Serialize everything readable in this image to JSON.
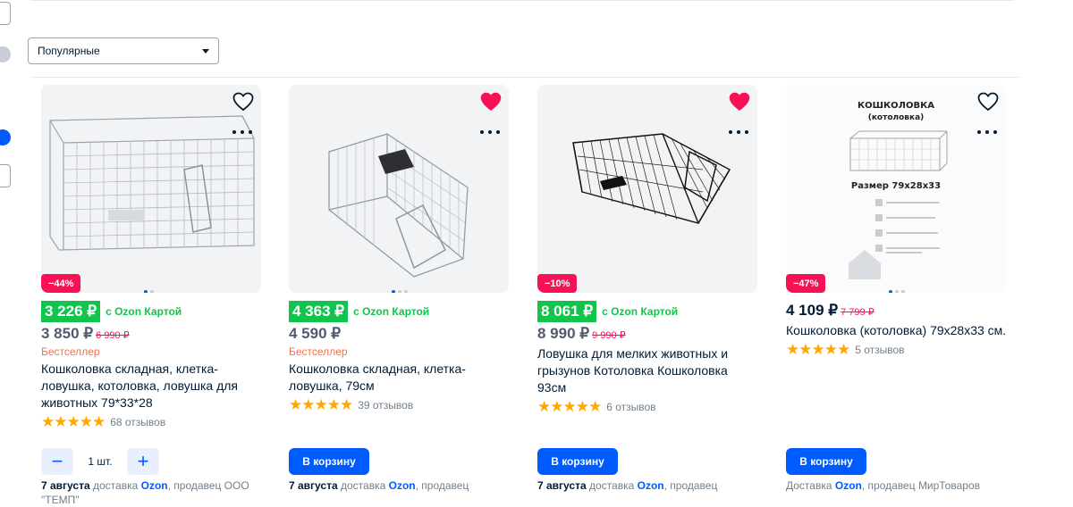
{
  "sort": {
    "label": "Популярные"
  },
  "cart_label": "В корзину",
  "stepper": {
    "minus": "−",
    "plus": "+",
    "qty": "1 шт."
  },
  "colors": {
    "accent": "#005bff",
    "green": "#10c44c",
    "discount": "#f91155",
    "bestseller": "#f1724d",
    "star": "#ffa800"
  },
  "products": [
    {
      "discount": "−44%",
      "card_price": "3 226 ₽",
      "ozon_card_label": "с Ozon Картой",
      "price": "3 850 ₽",
      "old_price": "6 990 ₽",
      "badge": "Бестселлер",
      "title": "Кошколовка складная, клетка-ловушка, котоловка, ловушка для животных 79*33*28",
      "stars": "★★★★★",
      "reviews": "68 отзывов",
      "favorite": false,
      "delivery_date": "7 августа",
      "delivery_text": "доставка",
      "delivery_ozon": "Ozon",
      "delivery_seller": ", продавец ООО \"ТЕМП\""
    },
    {
      "discount": "",
      "card_price": "4 363 ₽",
      "ozon_card_label": "с Ozon Картой",
      "price": "4 590 ₽",
      "old_price": "",
      "badge": "Бестселлер",
      "title": "Кошколовка складная, клетка-ловушка, 79см",
      "stars": "★★★★★",
      "reviews": "39 отзывов",
      "favorite": true,
      "delivery_date": "7 августа",
      "delivery_text": "доставка",
      "delivery_ozon": "Ozon",
      "delivery_seller": ", продавец"
    },
    {
      "discount": "−10%",
      "card_price": "8 061 ₽",
      "ozon_card_label": "с Ozon Картой",
      "price": "8 990 ₽",
      "old_price": "9 990 ₽",
      "badge": "",
      "title": "Ловушка для мелких животных и грызунов Котоловка Кошколовка 93см",
      "stars": "★★★★★",
      "reviews": "6 отзывов",
      "favorite": true,
      "delivery_date": "7 августа",
      "delivery_text": "доставка",
      "delivery_ozon": "Ozon",
      "delivery_seller": ", продавец"
    },
    {
      "discount": "−47%",
      "card_price": "",
      "ozon_card_label": "",
      "price": "4 109 ₽",
      "old_price": "7 799 ₽",
      "badge": "",
      "title": "Кошколовка (котоловка) 79х28х33 см.",
      "stars": "★★★★★",
      "reviews": "5 отзывов",
      "favorite": false,
      "delivery_date": "",
      "delivery_text": "Доставка",
      "delivery_ozon": "Ozon",
      "delivery_seller": ", продавец МирТоваров",
      "image_text": {
        "title": "КОШКОЛОВКА",
        "subtitle": "(котоловка)",
        "size": "Размер 79х28х33"
      }
    }
  ]
}
